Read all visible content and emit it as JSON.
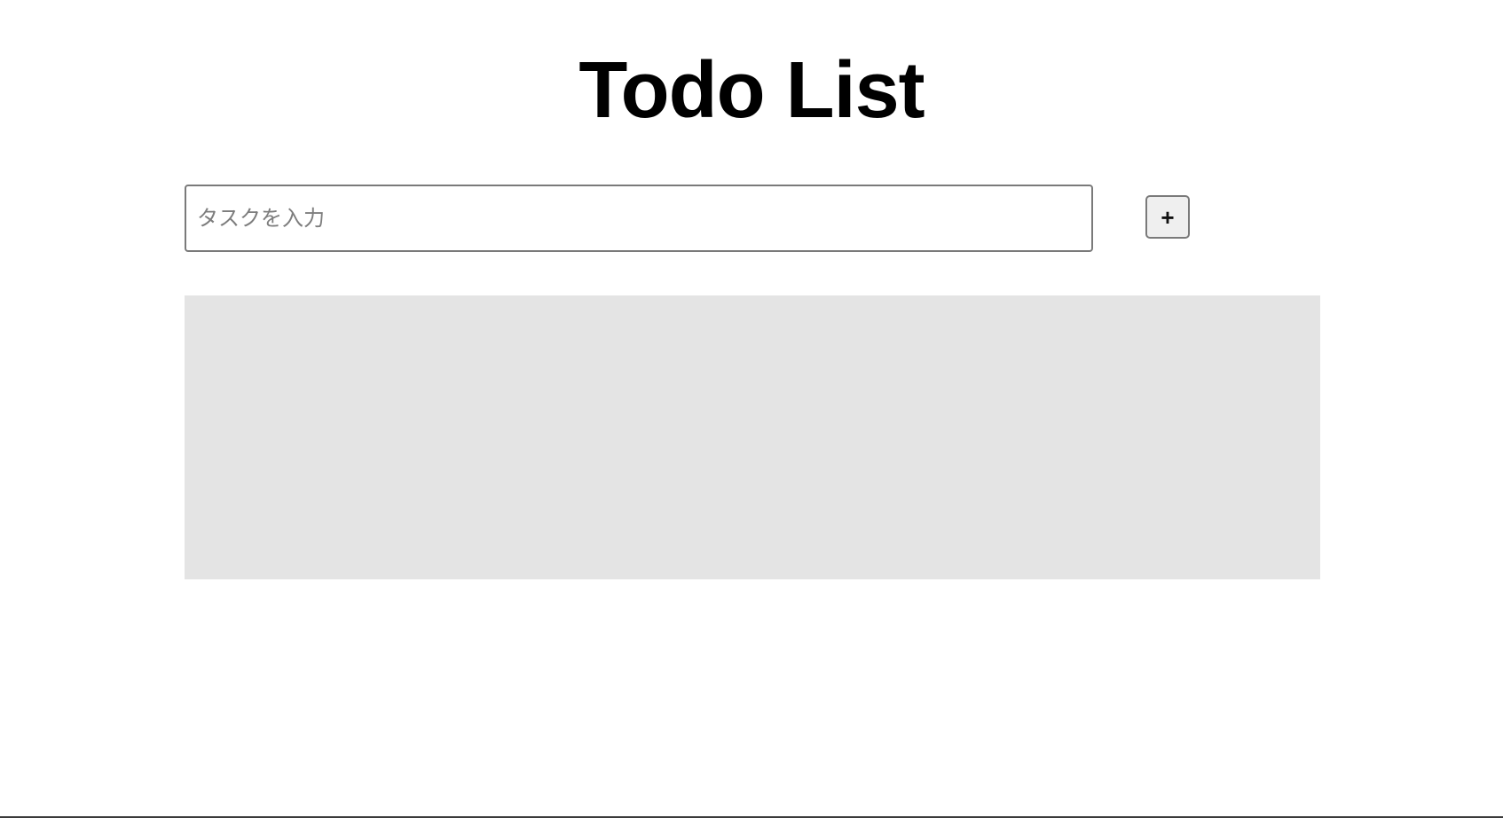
{
  "app": {
    "title": "Todo List"
  },
  "task_form": {
    "input_value": "",
    "input_placeholder": "タスクを入力",
    "add_button_label": "+"
  },
  "task_list": {
    "items": []
  }
}
